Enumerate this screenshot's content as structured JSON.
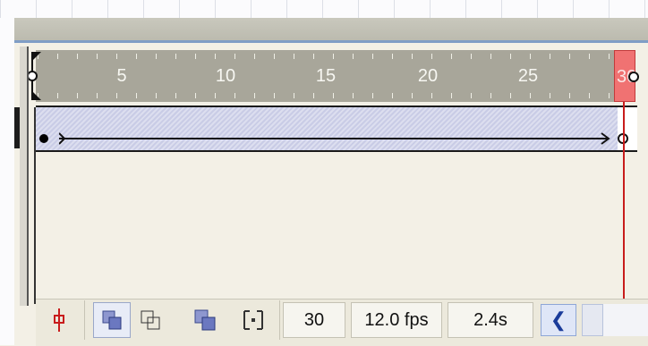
{
  "timeline": {
    "ruler_numbers": [
      "5",
      "10",
      "15",
      "20",
      "25",
      "30"
    ],
    "ruler_playhead_label": "30"
  },
  "layer": {
    "tween_type": "motion"
  },
  "status": {
    "current_frame": "30",
    "frame_rate": "12.0 fps",
    "elapsed_time": "2.4s"
  },
  "icons": {
    "center_frame": "center-frame-icon",
    "onion_skin": "onion-skin-icon",
    "onion_skin_outlines": "onion-skin-outlines-icon",
    "edit_multiple_frames": "edit-multiple-frames-icon",
    "modify_onion_markers": "modify-onion-markers-icon",
    "scroll_left": "scroll-left-icon"
  },
  "colors": {
    "playhead": "#c81c1c",
    "layer_fill": "#c9cce6",
    "ruler_bg": "#a8a69a",
    "nav_accent": "#1b3c9a"
  }
}
